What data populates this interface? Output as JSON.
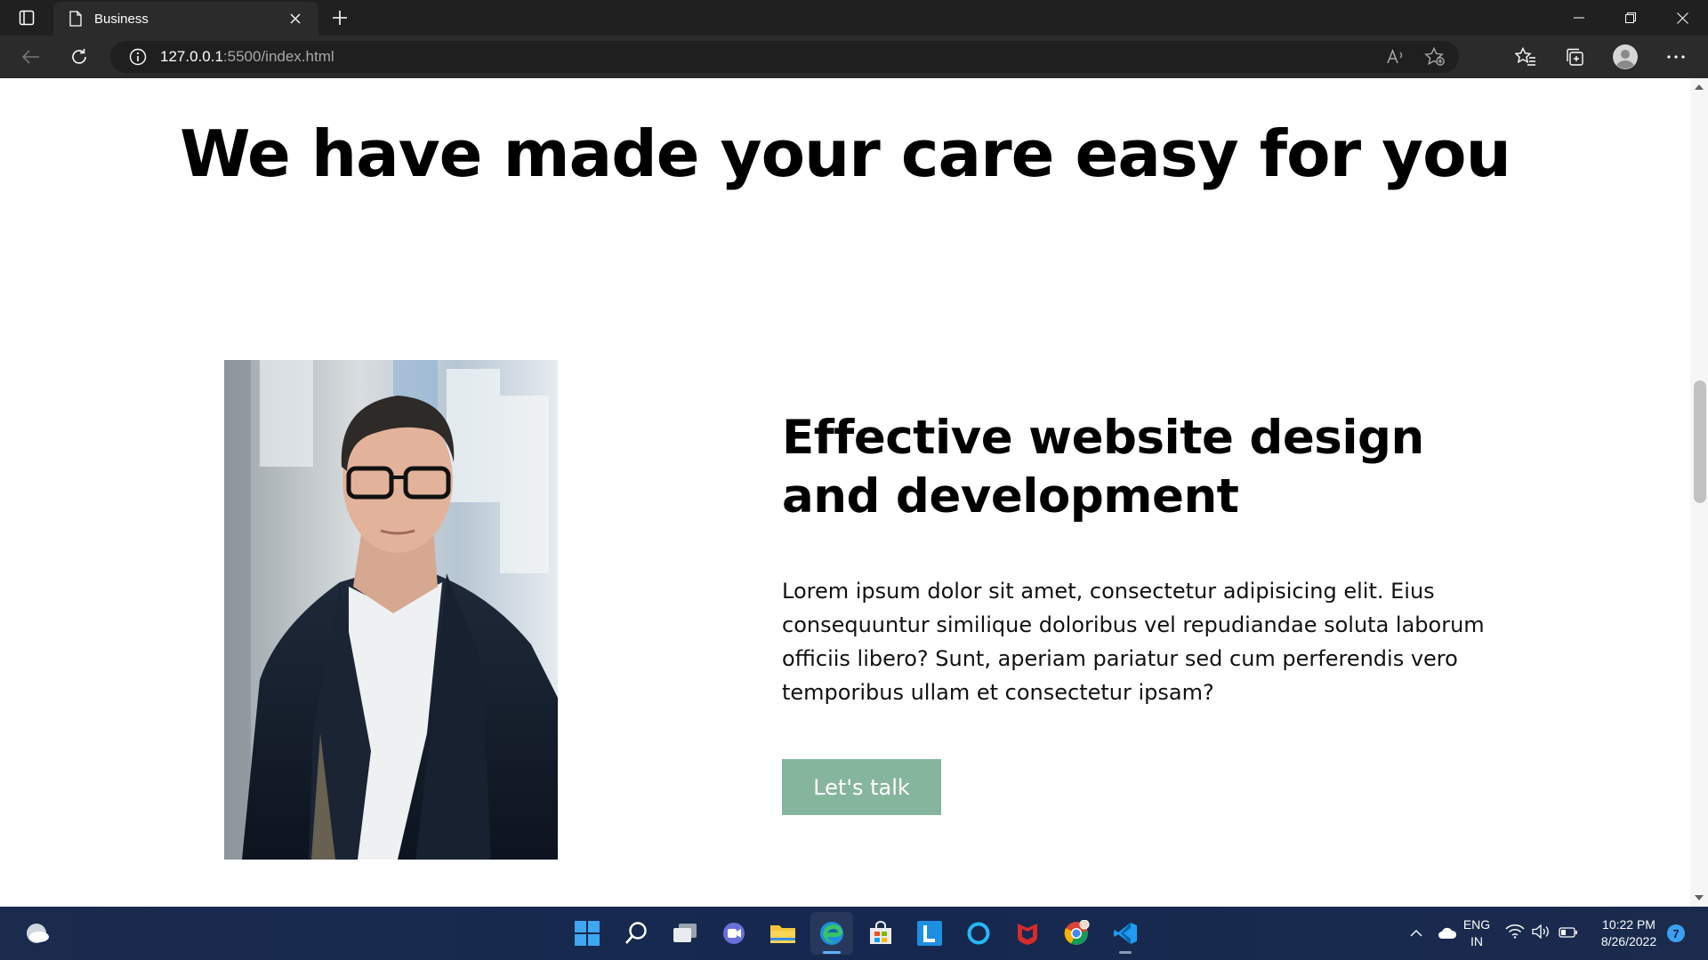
{
  "browser": {
    "tab_title": "Business",
    "url_host": "127.0.0.1",
    "url_path": ":5500/index.html"
  },
  "page": {
    "hero_title": "We have made your care easy for you",
    "feature_title": "Effective website design and development",
    "feature_text": "Lorem ipsum dolor sit amet, consectetur adipisicing elit. Eius consequuntur similique doloribus vel repudiandae soluta laborum officiis libero? Sunt, aperiam pariatur sed cum perferendis vero temporibus ullam et consectetur ipsam?",
    "cta_label": "Let's talk",
    "accent_color": "#86b59d"
  },
  "taskbar": {
    "apps": [
      "start-icon",
      "search-icon",
      "task-view-icon",
      "teams-chat-icon",
      "file-explorer-icon",
      "edge-icon",
      "store-icon",
      "l-app-icon",
      "cortana-icon",
      "mcafee-icon",
      "chrome-icon",
      "vscode-icon"
    ],
    "language_line1": "ENG",
    "language_line2": "IN",
    "time": "10:22 PM",
    "date": "8/26/2022",
    "notification_count": "7"
  }
}
